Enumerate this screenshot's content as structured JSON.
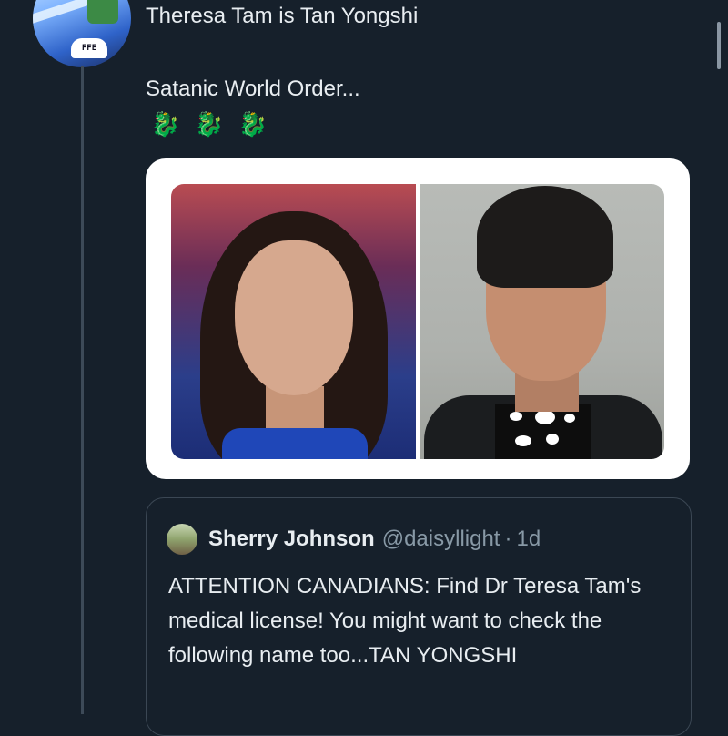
{
  "tweet": {
    "author_avatar_text": "FFE",
    "text_line1": "Theresa Tam is Tan Yongshi",
    "text_line2": "Satanic World Order...",
    "emojis": [
      "🐉",
      "🐉",
      "🐉"
    ]
  },
  "quoted_tweet": {
    "display_name": "Sherry Johnson",
    "handle": "@daisyllight",
    "separator": "·",
    "time": "1d",
    "body": "ATTENTION CANADIANS: Find Dr Teresa Tam's medical license! You might want to check the following name too...TAN YONGSHI"
  },
  "colors": {
    "background": "#16202b",
    "text": "#e8edf1",
    "secondary_text": "#8899a6",
    "thread_line": "#3d4a58"
  }
}
